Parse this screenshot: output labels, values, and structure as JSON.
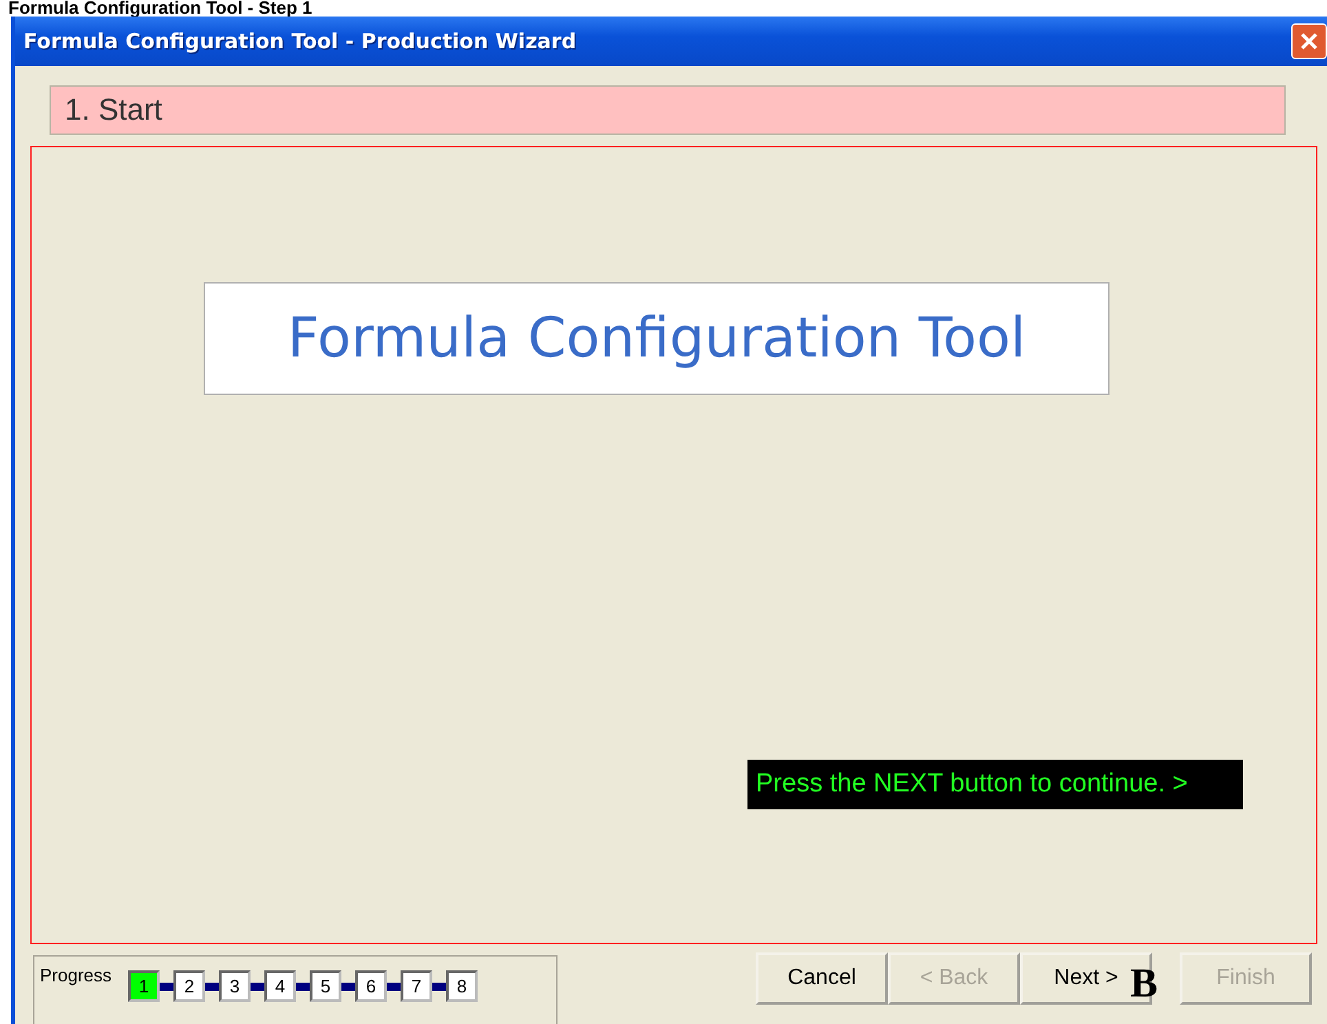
{
  "caption": "Formula Configuration Tool - Step 1",
  "window": {
    "title": "Formula Configuration Tool - Production Wizard"
  },
  "step_header": "1. Start",
  "panel": {
    "heading": "Formula Configuration Tool",
    "hint": "Press the NEXT button to continue. >"
  },
  "progress": {
    "label": "Progress",
    "steps": [
      {
        "label": "1",
        "selected": true
      },
      {
        "label": "2",
        "selected": false
      },
      {
        "label": "3",
        "selected": false
      },
      {
        "label": "4",
        "selected": false
      },
      {
        "label": "5",
        "selected": false
      },
      {
        "label": "6",
        "selected": false
      },
      {
        "label": "7",
        "selected": false
      },
      {
        "label": "8",
        "selected": false
      }
    ]
  },
  "buttons": [
    {
      "label": "Cancel",
      "disabled": false
    },
    {
      "label": "< Back",
      "disabled": true
    },
    {
      "label": "Next >",
      "disabled": false,
      "annotation": "B"
    },
    {
      "label": "Finish",
      "disabled": true
    }
  ]
}
